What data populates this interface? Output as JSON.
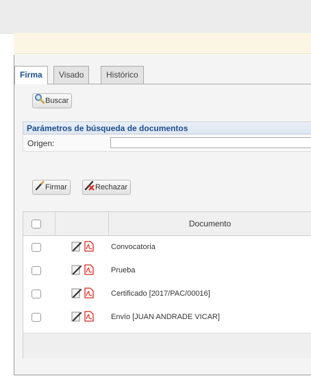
{
  "tabs": [
    {
      "label": "Firma",
      "active": true
    },
    {
      "label": "Visado",
      "active": false
    },
    {
      "label": "Histórico",
      "active": false
    }
  ],
  "buttons": {
    "search_label": "Buscar",
    "sign_label": "Firmar",
    "reject_label": "Rechazar"
  },
  "search_params": {
    "title": "Parámetros de búsqueda de documentos",
    "origin_label": "Origen:",
    "origin_value": ""
  },
  "table": {
    "column_document": "Documento",
    "rows": [
      {
        "name": "Convocatoria",
        "checked": false
      },
      {
        "name": "Prueba",
        "checked": false
      },
      {
        "name": "Certificado [2017/PAC/00016]",
        "checked": false
      },
      {
        "name": "Envío [JUAN ANDRADE VICAR]",
        "checked": false
      }
    ]
  },
  "icons": {
    "search": "magnifier-icon",
    "sign": "pen-icon",
    "reject": "pen-cross-icon",
    "document_sign": "sign-document-icon",
    "document_pdf": "pdf-icon"
  },
  "colors": {
    "accent": "#1d4f91",
    "notice_bg": "#fbf6e3",
    "pdf_red": "#d9281f"
  }
}
